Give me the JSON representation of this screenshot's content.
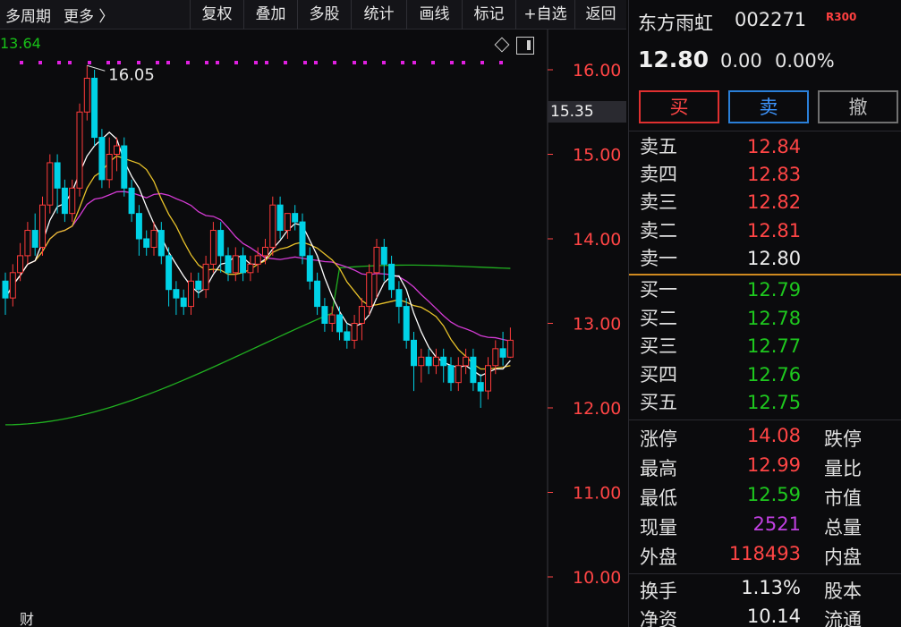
{
  "toolbar": {
    "period": "多周期",
    "more": "更多 〉",
    "buttons": [
      "复权",
      "叠加",
      "多股",
      "统计",
      "画线",
      "标记",
      "+自选",
      "返回"
    ]
  },
  "chart": {
    "ma_value": "13.64",
    "high_marker": "16.05",
    "crosshair_price": "15.35",
    "price_axis": [
      "16.00",
      "15.00",
      "14.00",
      "13.00",
      "12.00",
      "11.00",
      "10.00"
    ],
    "bottom_label": "财",
    "colors": {
      "up": "#ff3b3b",
      "down": "#00d2e6",
      "ma5": "#ffffff",
      "ma10": "#e8c22a",
      "ma20": "#d43bd4",
      "ma60": "#20b020",
      "marker": "#e020e0"
    }
  },
  "chart_data": {
    "type": "candlestick",
    "ylim": [
      10.0,
      16.6
    ],
    "candles": [
      {
        "o": 13.5,
        "c": 13.3,
        "h": 13.6,
        "l": 13.1
      },
      {
        "o": 13.3,
        "c": 13.6,
        "h": 13.7,
        "l": 13.2
      },
      {
        "o": 13.6,
        "c": 13.8,
        "h": 13.95,
        "l": 13.5
      },
      {
        "o": 13.8,
        "c": 14.1,
        "h": 14.2,
        "l": 13.7
      },
      {
        "o": 14.1,
        "c": 13.9,
        "h": 14.3,
        "l": 13.8
      },
      {
        "o": 13.9,
        "c": 14.4,
        "h": 14.5,
        "l": 13.8
      },
      {
        "o": 14.4,
        "c": 14.9,
        "h": 15.0,
        "l": 14.3
      },
      {
        "o": 14.9,
        "c": 14.6,
        "h": 15.0,
        "l": 14.3
      },
      {
        "o": 14.6,
        "c": 14.3,
        "h": 14.7,
        "l": 14.2
      },
      {
        "o": 14.3,
        "c": 14.6,
        "h": 14.7,
        "l": 14.2
      },
      {
        "o": 14.6,
        "c": 15.5,
        "h": 15.6,
        "l": 14.5
      },
      {
        "o": 15.5,
        "c": 15.9,
        "h": 16.05,
        "l": 15.4
      },
      {
        "o": 15.9,
        "c": 15.2,
        "h": 16.0,
        "l": 15.1
      },
      {
        "o": 15.2,
        "c": 14.7,
        "h": 15.3,
        "l": 14.6
      },
      {
        "o": 14.7,
        "c": 15.0,
        "h": 15.2,
        "l": 14.6
      },
      {
        "o": 15.0,
        "c": 15.1,
        "h": 15.2,
        "l": 14.8
      },
      {
        "o": 15.1,
        "c": 14.6,
        "h": 15.2,
        "l": 14.5
      },
      {
        "o": 14.6,
        "c": 14.3,
        "h": 14.7,
        "l": 14.2
      },
      {
        "o": 14.3,
        "c": 14.0,
        "h": 14.4,
        "l": 13.8
      },
      {
        "o": 14.0,
        "c": 13.9,
        "h": 14.1,
        "l": 13.8
      },
      {
        "o": 13.9,
        "c": 14.1,
        "h": 14.2,
        "l": 13.8
      },
      {
        "o": 14.1,
        "c": 13.8,
        "h": 14.2,
        "l": 13.7
      },
      {
        "o": 13.8,
        "c": 13.4,
        "h": 13.9,
        "l": 13.2
      },
      {
        "o": 13.4,
        "c": 13.3,
        "h": 13.5,
        "l": 13.1
      },
      {
        "o": 13.3,
        "c": 13.2,
        "h": 13.4,
        "l": 13.1
      },
      {
        "o": 13.2,
        "c": 13.5,
        "h": 13.6,
        "l": 13.1
      },
      {
        "o": 13.5,
        "c": 13.4,
        "h": 13.6,
        "l": 13.3
      },
      {
        "o": 13.4,
        "c": 13.7,
        "h": 13.8,
        "l": 13.3
      },
      {
        "o": 13.7,
        "c": 14.1,
        "h": 14.2,
        "l": 13.6
      },
      {
        "o": 14.1,
        "c": 13.8,
        "h": 14.2,
        "l": 13.6
      },
      {
        "o": 13.8,
        "c": 13.6,
        "h": 13.9,
        "l": 13.5
      },
      {
        "o": 13.6,
        "c": 13.8,
        "h": 13.9,
        "l": 13.5
      },
      {
        "o": 13.8,
        "c": 13.6,
        "h": 13.9,
        "l": 13.5
      },
      {
        "o": 13.6,
        "c": 13.7,
        "h": 13.8,
        "l": 13.5
      },
      {
        "o": 13.7,
        "c": 13.8,
        "h": 13.9,
        "l": 13.6
      },
      {
        "o": 13.8,
        "c": 13.9,
        "h": 14.0,
        "l": 13.7
      },
      {
        "o": 13.9,
        "c": 14.4,
        "h": 14.5,
        "l": 13.8
      },
      {
        "o": 14.4,
        "c": 14.1,
        "h": 14.5,
        "l": 14.0
      },
      {
        "o": 14.1,
        "c": 14.3,
        "h": 14.3,
        "l": 14.0
      },
      {
        "o": 14.3,
        "c": 14.2,
        "h": 14.4,
        "l": 14.1
      },
      {
        "o": 14.2,
        "c": 13.8,
        "h": 14.3,
        "l": 13.7
      },
      {
        "o": 13.8,
        "c": 13.5,
        "h": 13.9,
        "l": 13.4
      },
      {
        "o": 13.5,
        "c": 13.2,
        "h": 13.6,
        "l": 13.1
      },
      {
        "o": 13.2,
        "c": 13.0,
        "h": 13.3,
        "l": 12.9
      },
      {
        "o": 13.0,
        "c": 13.1,
        "h": 13.2,
        "l": 12.9
      },
      {
        "o": 13.1,
        "c": 12.9,
        "h": 13.2,
        "l": 12.8
      },
      {
        "o": 12.9,
        "c": 12.8,
        "h": 13.0,
        "l": 12.7
      },
      {
        "o": 12.8,
        "c": 13.0,
        "h": 13.1,
        "l": 12.7
      },
      {
        "o": 13.0,
        "c": 13.2,
        "h": 13.3,
        "l": 12.8
      },
      {
        "o": 13.2,
        "c": 13.6,
        "h": 13.7,
        "l": 13.1
      },
      {
        "o": 13.6,
        "c": 13.9,
        "h": 14.0,
        "l": 13.3
      },
      {
        "o": 13.9,
        "c": 13.7,
        "h": 14.0,
        "l": 13.5
      },
      {
        "o": 13.7,
        "c": 13.4,
        "h": 13.8,
        "l": 13.3
      },
      {
        "o": 13.4,
        "c": 13.2,
        "h": 13.5,
        "l": 13.0
      },
      {
        "o": 13.2,
        "c": 12.8,
        "h": 13.3,
        "l": 12.7
      },
      {
        "o": 12.8,
        "c": 12.5,
        "h": 12.9,
        "l": 12.2
      },
      {
        "o": 12.5,
        "c": 12.6,
        "h": 12.7,
        "l": 12.3
      },
      {
        "o": 12.6,
        "c": 12.5,
        "h": 12.7,
        "l": 12.4
      },
      {
        "o": 12.5,
        "c": 12.6,
        "h": 12.7,
        "l": 12.4
      },
      {
        "o": 12.6,
        "c": 12.5,
        "h": 12.7,
        "l": 12.3
      },
      {
        "o": 12.5,
        "c": 12.3,
        "h": 12.6,
        "l": 12.2
      },
      {
        "o": 12.3,
        "c": 12.5,
        "h": 12.6,
        "l": 12.2
      },
      {
        "o": 12.5,
        "c": 12.6,
        "h": 12.7,
        "l": 12.4
      },
      {
        "o": 12.6,
        "c": 12.3,
        "h": 12.7,
        "l": 12.2
      },
      {
        "o": 12.3,
        "c": 12.2,
        "h": 12.4,
        "l": 12.0
      },
      {
        "o": 12.2,
        "c": 12.5,
        "h": 12.6,
        "l": 12.1
      },
      {
        "o": 12.5,
        "c": 12.7,
        "h": 12.8,
        "l": 12.4
      },
      {
        "o": 12.7,
        "c": 12.6,
        "h": 12.9,
        "l": 12.5
      },
      {
        "o": 12.6,
        "c": 12.8,
        "h": 12.95,
        "l": 12.59
      }
    ],
    "ma60_endpoints": [
      11.8,
      13.65
    ],
    "marker_rows_count": 30
  },
  "panel": {
    "name": "东方雨虹",
    "code": "002271",
    "badge": "R300",
    "price": "12.80",
    "change": "0.00",
    "change_pct": "0.00%",
    "actions": {
      "buy": "买",
      "sell": "卖",
      "cancel": "撤"
    },
    "asks": [
      {
        "label": "卖五",
        "price": "12.84"
      },
      {
        "label": "卖四",
        "price": "12.83"
      },
      {
        "label": "卖三",
        "price": "12.82"
      },
      {
        "label": "卖二",
        "price": "12.81"
      },
      {
        "label": "卖一",
        "price": "12.80"
      }
    ],
    "bids": [
      {
        "label": "买一",
        "price": "12.79"
      },
      {
        "label": "买二",
        "price": "12.78"
      },
      {
        "label": "买三",
        "price": "12.77"
      },
      {
        "label": "买四",
        "price": "12.76"
      },
      {
        "label": "买五",
        "price": "12.75"
      }
    ],
    "stats": [
      {
        "label": "涨停",
        "value": "14.08",
        "label2": "跌停"
      },
      {
        "label": "最高",
        "value": "12.99",
        "label2": "量比"
      },
      {
        "label": "最低",
        "value": "12.59",
        "label2": "市值"
      },
      {
        "label": "现量",
        "value": "2521",
        "label2": "总量"
      },
      {
        "label": "外盘",
        "value": "118493",
        "label2": "内盘"
      }
    ],
    "stats2": [
      {
        "label": "换手",
        "value": "1.13%",
        "label2": "股本"
      },
      {
        "label": "净资",
        "value": "10.14",
        "label2": "流通"
      }
    ]
  }
}
